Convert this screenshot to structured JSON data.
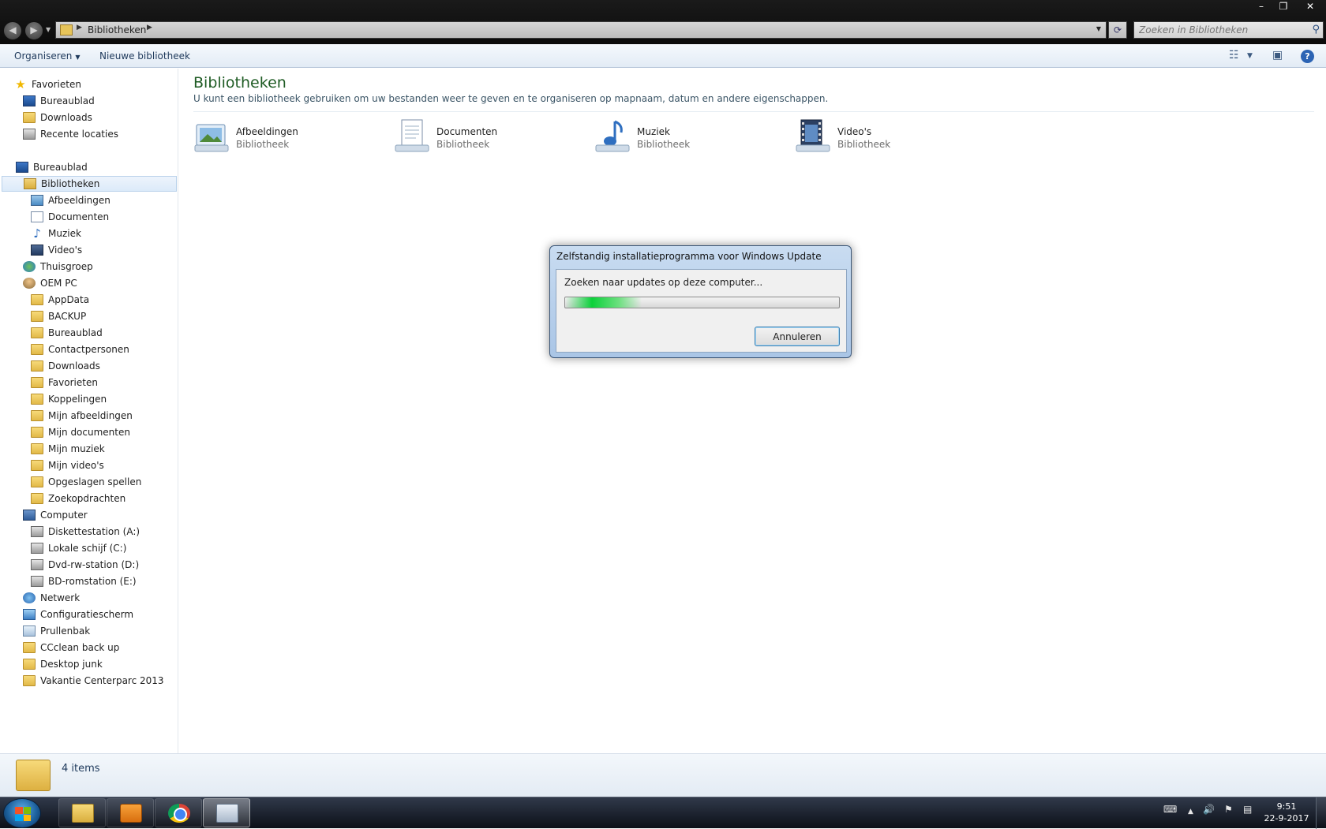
{
  "window": {
    "minimize": "–",
    "maximize": "❐",
    "close": "✕"
  },
  "addressbar": {
    "breadcrumb": "Bibliotheken",
    "search_placeholder": "Zoeken in Bibliotheken"
  },
  "toolbar": {
    "organize": "Organiseren",
    "new_library": "Nieuwe bibliotheek"
  },
  "nav": {
    "favorites": "Favorieten",
    "fav_desktop": "Bureaublad",
    "fav_downloads": "Downloads",
    "fav_recent": "Recente locaties",
    "desktop": "Bureaublad",
    "libraries": "Bibliotheken",
    "lib_pictures": "Afbeeldingen",
    "lib_documents": "Documenten",
    "lib_music": "Muziek",
    "lib_videos": "Video's",
    "homegroup": "Thuisgroep",
    "user": "OEM PC",
    "user_appdata": "AppData",
    "user_backup": "BACKUP",
    "user_desktop": "Bureaublad",
    "user_contacts": "Contactpersonen",
    "user_downloads": "Downloads",
    "user_favorites": "Favorieten",
    "user_links": "Koppelingen",
    "user_pictures": "Mijn afbeeldingen",
    "user_documents": "Mijn documenten",
    "user_music": "Mijn muziek",
    "user_videos": "Mijn video's",
    "user_savedgames": "Opgeslagen spellen",
    "user_searches": "Zoekopdrachten",
    "computer": "Computer",
    "drive_a": "Diskettestation (A:)",
    "drive_c": "Lokale schijf (C:)",
    "drive_d": "Dvd-rw-station (D:)",
    "drive_e": "BD-romstation (E:)",
    "network": "Netwerk",
    "control_panel": "Configuratiescherm",
    "recycle_bin": "Prullenbak",
    "folder_ccclean": "CCclean back up",
    "folder_desktopjunk": "Desktop junk",
    "folder_vakantie": "Vakantie Centerparc 2013"
  },
  "content": {
    "title": "Bibliotheken",
    "subtitle": "U kunt een bibliotheek gebruiken om uw bestanden weer te geven en te organiseren op mapnaam, datum en andere eigenschappen.",
    "libraries": [
      {
        "name": "Afbeeldingen",
        "type": "Bibliotheek"
      },
      {
        "name": "Documenten",
        "type": "Bibliotheek"
      },
      {
        "name": "Muziek",
        "type": "Bibliotheek"
      },
      {
        "name": "Video's",
        "type": "Bibliotheek"
      }
    ]
  },
  "dialog": {
    "title": "Zelfstandig installatieprogramma voor Windows Update",
    "message": "Zoeken naar updates op deze computer...",
    "cancel": "Annuleren",
    "progress_note": "indeterminate marquee"
  },
  "status": {
    "items": "4 items"
  },
  "taskbar": {
    "time": "9:51",
    "date": "22-9-2017"
  }
}
